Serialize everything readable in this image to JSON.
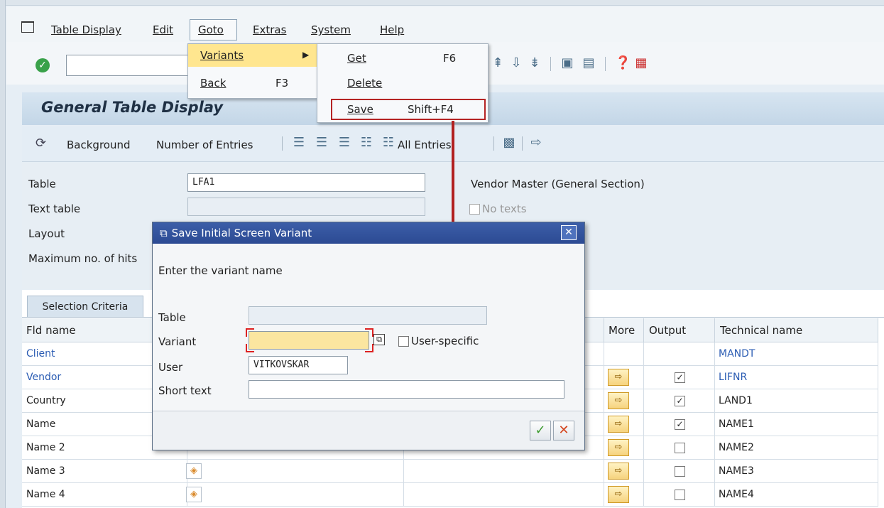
{
  "menubar": {
    "items": [
      "Table Display",
      "Edit",
      "Goto",
      "Extras",
      "System",
      "Help"
    ]
  },
  "page": {
    "title": "General Table Display"
  },
  "app_toolbar": {
    "background_label": "Background",
    "number_entries_label": "Number of Entries",
    "all_entries_label": "All Entries"
  },
  "form": {
    "table_label": "Table",
    "table_value": "LFA1",
    "table_desc": "Vendor Master (General Section)",
    "text_table_label": "Text table",
    "no_texts_label": "No texts",
    "layout_label": "Layout",
    "max_hits_label": "Maximum no. of hits"
  },
  "selection": {
    "tab_label": "Selection Criteria",
    "col_fld_name": "Fld name",
    "col_more": "More",
    "col_output": "Output",
    "col_technical": "Technical name",
    "rows": [
      {
        "name": "Client",
        "technical": "MANDT",
        "checked": "",
        "blue": true
      },
      {
        "name": "Vendor",
        "technical": "LIFNR",
        "checked": "✓",
        "blue": true
      },
      {
        "name": "Country",
        "technical": "LAND1",
        "checked": "✓",
        "blue": false
      },
      {
        "name": "Name",
        "technical": "NAME1",
        "checked": "✓",
        "blue": false
      },
      {
        "name": "Name 2",
        "technical": "NAME2",
        "checked": "",
        "blue": false
      },
      {
        "name": "Name 3",
        "technical": "NAME3",
        "checked": "",
        "blue": false
      },
      {
        "name": "Name 4",
        "technical": "NAME4",
        "checked": "",
        "blue": false
      }
    ]
  },
  "goto_menu": {
    "variants_label": "Variants",
    "back_label": "Back",
    "back_shortcut": "F3"
  },
  "variants_submenu": {
    "get_label": "Get",
    "get_shortcut": "F6",
    "delete_label": "Delete",
    "save_label": "Save",
    "save_shortcut": "Shift+F4"
  },
  "dialog": {
    "title": "Save Initial Screen Variant",
    "prompt": "Enter the variant name",
    "table_label": "Table",
    "variant_label": "Variant",
    "user_specific_label": "User-specific",
    "user_label": "User",
    "user_value": "VITKOVSKAR",
    "short_text_label": "Short text"
  },
  "colors": {
    "accent_red": "#b22020",
    "title_blue": "#2c4a93",
    "link_blue": "#2b5cb3"
  }
}
